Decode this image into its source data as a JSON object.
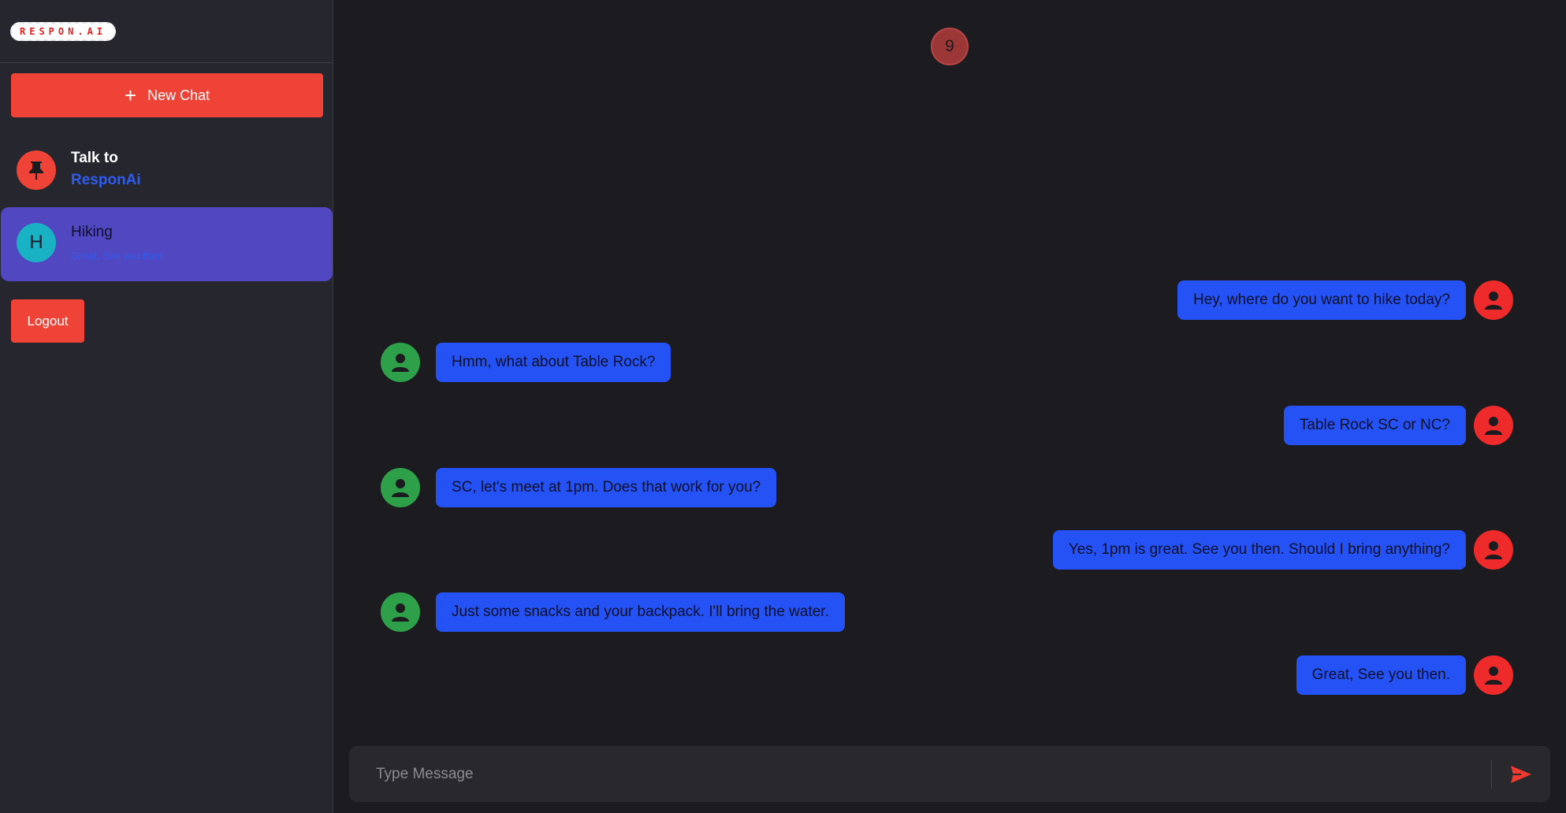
{
  "brand": {
    "logo_text": "RESPON.AI"
  },
  "sidebar": {
    "new_chat_label": "New Chat",
    "pinned": {
      "title": "Talk to",
      "subtitle": "ResponAi",
      "icon": "pin-icon"
    },
    "chats": [
      {
        "avatar_letter": "H",
        "name": "Hiking",
        "preview": "Great, See you then",
        "active": true
      }
    ],
    "logout_label": "Logout"
  },
  "main": {
    "counter": "9",
    "messages": [
      {
        "side": "right",
        "text": "Hey, where do you want to hike today?"
      },
      {
        "side": "left",
        "text": "Hmm, what about Table Rock?"
      },
      {
        "side": "right",
        "text": "Table Rock SC or NC?"
      },
      {
        "side": "left",
        "text": "SC, let's meet at 1pm. Does that work for you?"
      },
      {
        "side": "right",
        "text": "Yes, 1pm is great. See you then. Should I bring anything?"
      },
      {
        "side": "left",
        "text": "Just some snacks and your backpack. I'll bring the water."
      },
      {
        "side": "right",
        "text": "Great, See you then."
      }
    ],
    "input": {
      "placeholder": "Type Message",
      "value": ""
    }
  },
  "colors": {
    "accent": "#f04338",
    "bubble": "#2452f5",
    "active_chat": "#5147c0",
    "user_avatar": "#ee2a2a",
    "peer_avatar": "#2fa04a"
  }
}
